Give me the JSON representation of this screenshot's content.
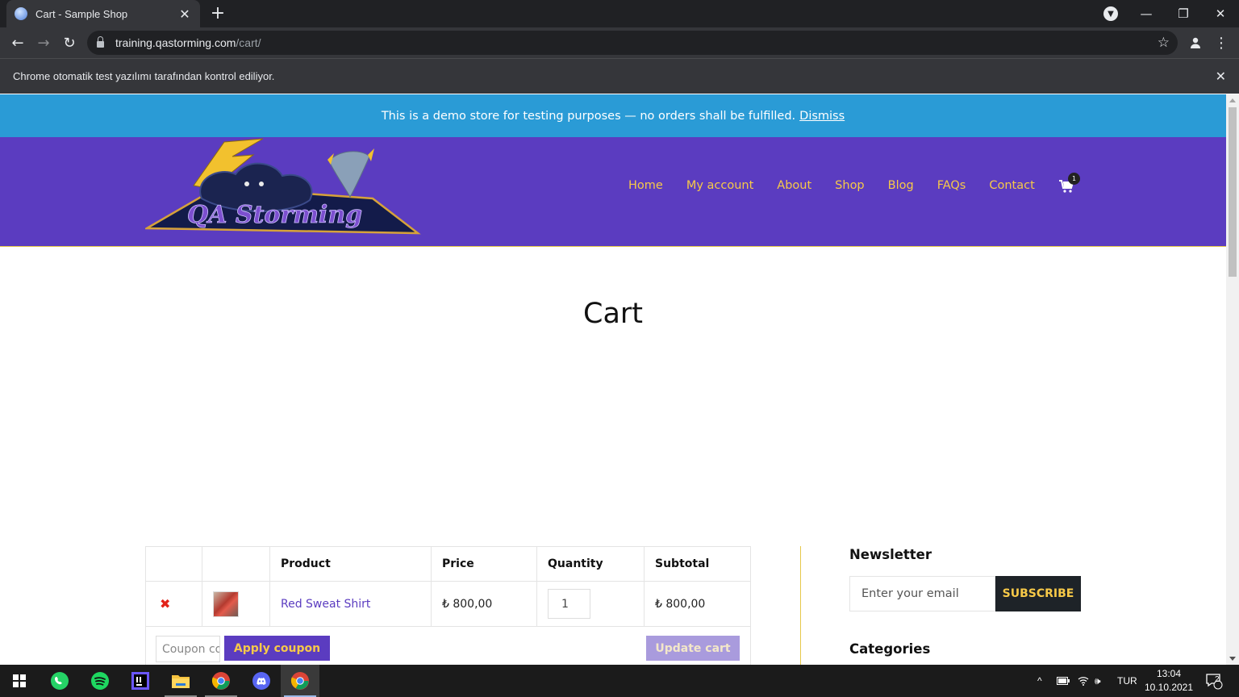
{
  "browser": {
    "tab_title": "Cart - Sample Shop",
    "url_host": "training.qastorming.com",
    "url_path": "/cart/",
    "infobar_text": "Chrome otomatik test yazılımı tarafından kontrol ediliyor."
  },
  "store": {
    "demo_notice": "This is a demo store for testing purposes — no orders shall be fulfilled.",
    "dismiss_label": "Dismiss",
    "logo_text": "QA Storming",
    "nav": [
      "Home",
      "My account",
      "About",
      "Shop",
      "Blog",
      "FAQs",
      "Contact"
    ],
    "cart_count": "1"
  },
  "page": {
    "title": "Cart"
  },
  "cart": {
    "headers": [
      "",
      "",
      "Product",
      "Price",
      "Quantity",
      "Subtotal"
    ],
    "items": [
      {
        "remove": "✖",
        "name": "Red Sweat Shirt",
        "price": "₺ 800,00",
        "quantity": "1",
        "subtotal": "₺ 800,00"
      }
    ],
    "coupon_placeholder": "Coupon code",
    "apply_coupon_label": "Apply coupon",
    "update_cart_label": "Update cart"
  },
  "sidebar": {
    "newsletter_title": "Newsletter",
    "email_placeholder": "Enter your email",
    "subscribe_label": "SUBSCRIBE",
    "categories_title": "Categories"
  },
  "taskbar": {
    "apps": [
      "whatsapp-icon",
      "spotify-icon",
      "intellij-icon",
      "file-explorer-icon",
      "chrome-icon",
      "discord-icon",
      "chrome-icon"
    ],
    "language": "TUR",
    "time": "13:04",
    "date": "10.10.2021",
    "notification_count": "2"
  },
  "colors": {
    "demo_bar": "#2a9bd6",
    "header": "#5b3cc0",
    "accent_yellow": "#f7c948",
    "remove_red": "#e2231a"
  }
}
